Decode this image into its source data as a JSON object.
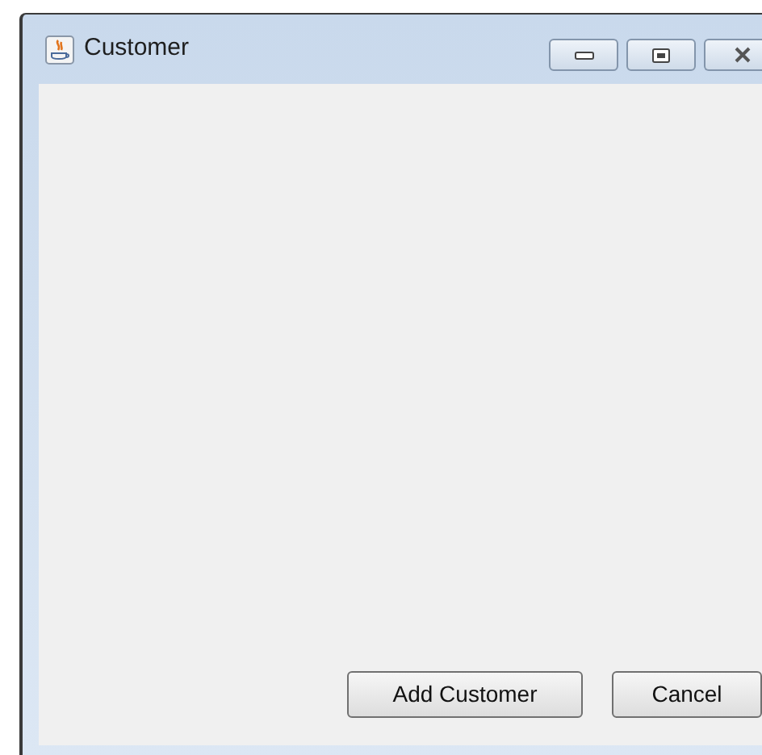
{
  "window": {
    "title": "Customer"
  },
  "buttons": [
    {
      "label": "Add Customer"
    },
    {
      "label": "Cancel"
    }
  ]
}
